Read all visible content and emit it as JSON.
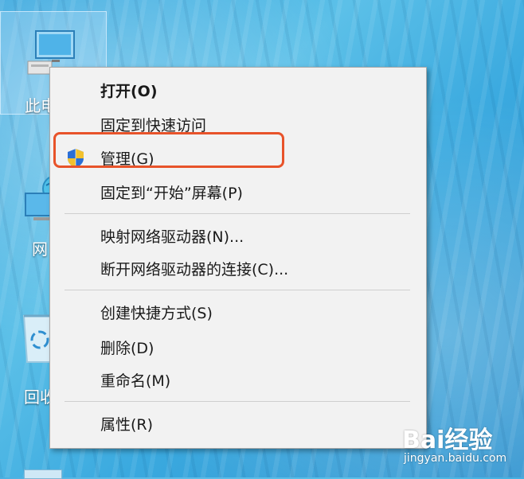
{
  "desktop": {
    "icons": [
      {
        "label": "此电",
        "icon": "computer-icon",
        "selected": true
      },
      {
        "label": "网",
        "icon": "network-icon",
        "selected": false
      },
      {
        "label": "回收",
        "icon": "recycle-bin-icon",
        "selected": false
      }
    ]
  },
  "context_menu": {
    "items": [
      {
        "label": "打开(O)",
        "default": true
      },
      {
        "label": "固定到快速访问"
      },
      {
        "label": "管理(G)",
        "icon": "uac-shield-icon",
        "highlighted": true
      },
      {
        "label": "固定到“开始”屏幕(P)"
      },
      {
        "label": "映射网络驱动器(N)..."
      },
      {
        "label": "断开网络驱动器的连接(C)..."
      },
      {
        "label": "创建快捷方式(S)"
      },
      {
        "label": "删除(D)"
      },
      {
        "label": "重命名(M)"
      },
      {
        "label": "属性(R)"
      }
    ],
    "highlight_color": "#e8532a"
  },
  "watermark": {
    "logo_text": "Bai经验",
    "url": "jingyan.baidu.com"
  }
}
